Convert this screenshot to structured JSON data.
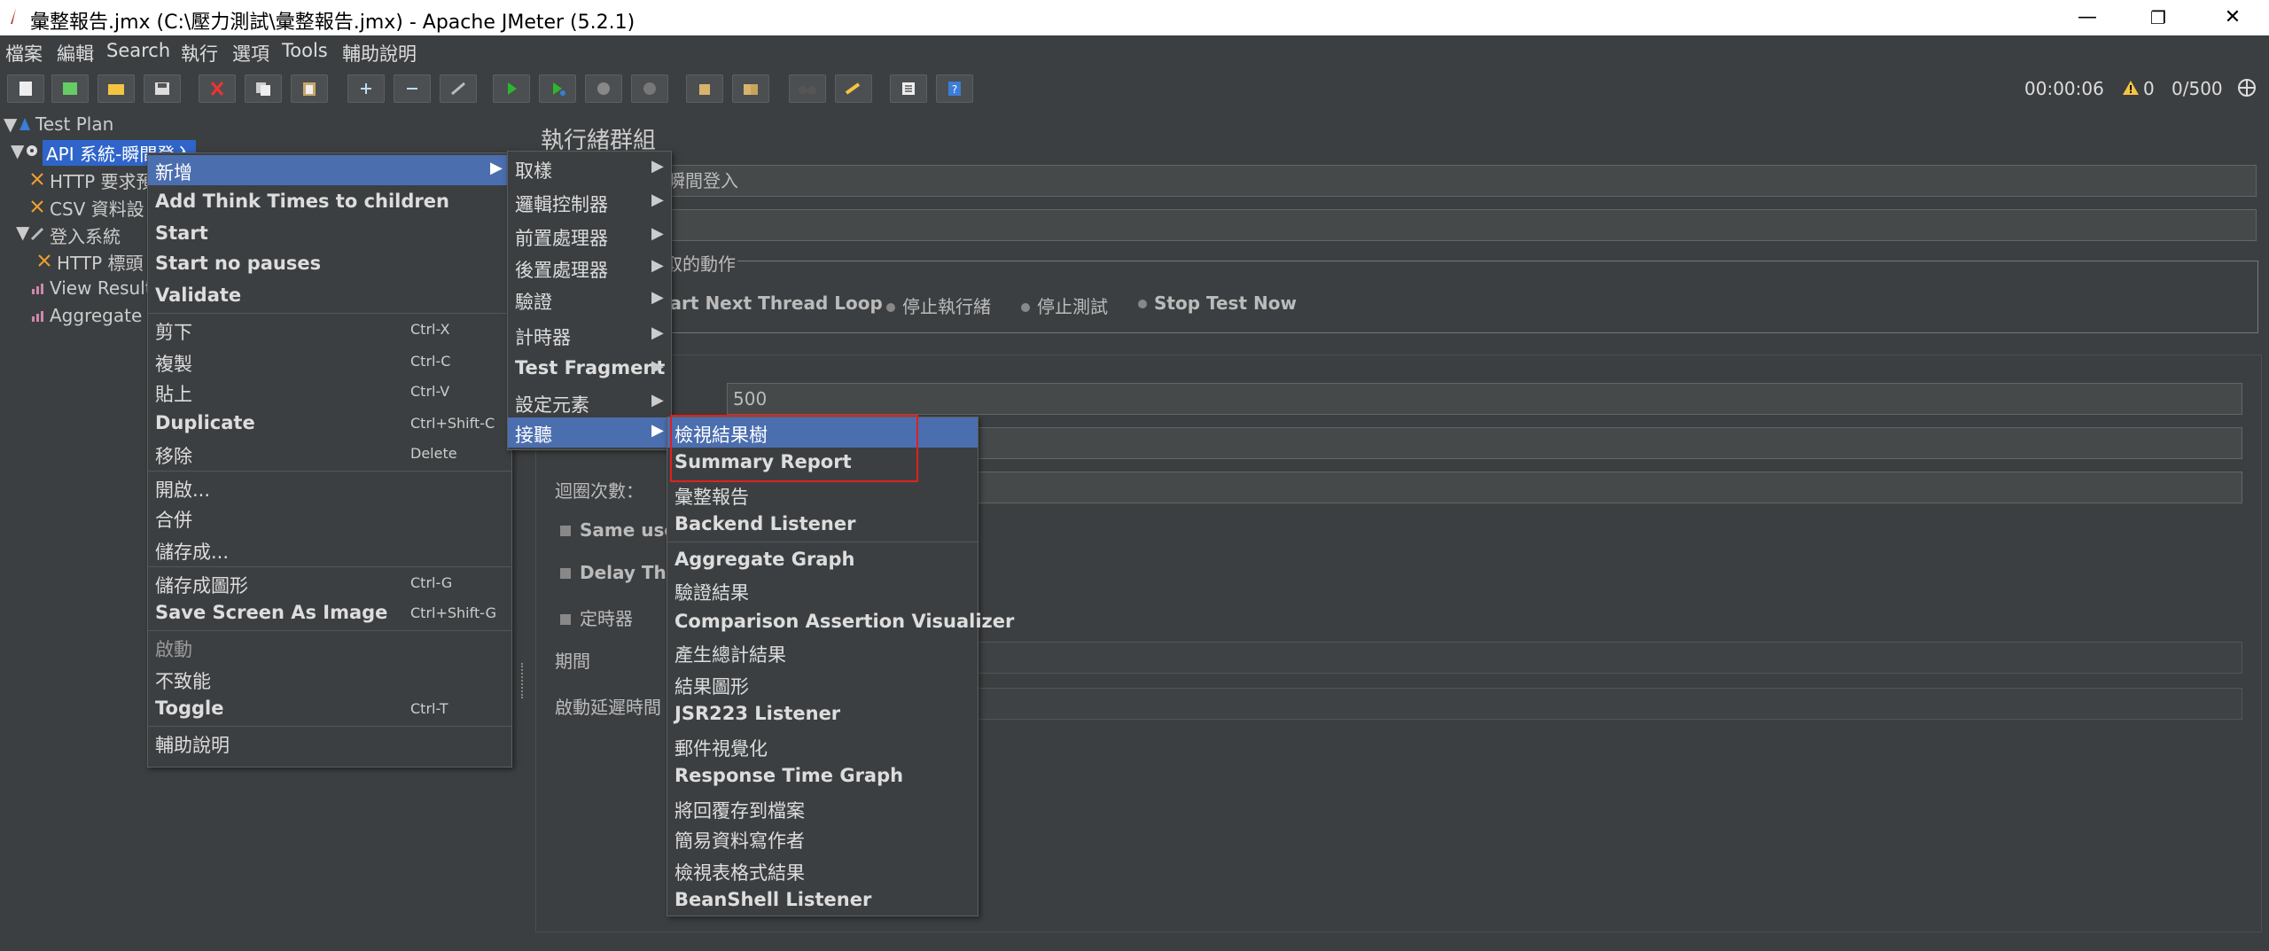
{
  "window": {
    "title": "彙整報告.jmx (C:\\壓力測試\\彙整報告.jmx) - Apache JMeter (5.2.1)",
    "minimize": "—",
    "restore": "❐",
    "close": "✕"
  },
  "menubar": [
    "檔案",
    "編輯",
    "Search",
    "執行",
    "選項",
    "Tools",
    "輔助說明"
  ],
  "status": {
    "timer": "00:00:06",
    "warnings": "0",
    "threads": "0/500"
  },
  "tree": [
    {
      "label": "Test Plan"
    },
    {
      "label": "API 系統-瞬間登入"
    },
    {
      "label": "HTTP 要求預"
    },
    {
      "label": "CSV 資料設"
    },
    {
      "label": "登入系統"
    },
    {
      "label": "HTTP 標頭"
    },
    {
      "label": "View Result"
    },
    {
      "label": "Aggregate R"
    }
  ],
  "panel": {
    "title": "執行緒群組",
    "name_value": "瞬間登入",
    "action_legend": "取的動作",
    "actions": [
      "tart Next Thread Loop",
      "停止執行緒",
      "停止測試",
      "Stop Test Now"
    ],
    "threads_value": "500",
    "loop_label": "迴圈次數：",
    "same_user": "Same use",
    "delay_thread": "Delay Thre",
    "scheduler": "定時器",
    "duration": "期間",
    "startup_delay": "啟動延遲時間"
  },
  "context_menu": [
    {
      "label": "新增",
      "shortcut": "",
      "arrow": "▶"
    },
    {
      "label": "Add Think Times to children",
      "shortcut": ""
    },
    {
      "label": "Start",
      "shortcut": ""
    },
    {
      "label": "Start no pauses",
      "shortcut": ""
    },
    {
      "label": "Validate",
      "shortcut": ""
    },
    {
      "label": "剪下",
      "shortcut": "Ctrl-X"
    },
    {
      "label": "複製",
      "shortcut": "Ctrl-C"
    },
    {
      "label": "貼上",
      "shortcut": "Ctrl-V"
    },
    {
      "label": "Duplicate",
      "shortcut": "Ctrl+Shift-C"
    },
    {
      "label": "移除",
      "shortcut": "Delete"
    },
    {
      "label": "開啟...",
      "shortcut": ""
    },
    {
      "label": "合併",
      "shortcut": ""
    },
    {
      "label": "儲存成...",
      "shortcut": ""
    },
    {
      "label": "儲存成圖形",
      "shortcut": "Ctrl-G"
    },
    {
      "label": "Save Screen As Image",
      "shortcut": "Ctrl+Shift-G"
    },
    {
      "label": "啟動",
      "shortcut": ""
    },
    {
      "label": "不致能",
      "shortcut": ""
    },
    {
      "label": "Toggle",
      "shortcut": "Ctrl-T"
    },
    {
      "label": "輔助說明",
      "shortcut": ""
    }
  ],
  "add_submenu": [
    {
      "label": "取樣",
      "arrow": "▶"
    },
    {
      "label": "邏輯控制器",
      "arrow": "▶"
    },
    {
      "label": "前置處理器",
      "arrow": "▶"
    },
    {
      "label": "後置處理器",
      "arrow": "▶"
    },
    {
      "label": "驗證",
      "arrow": "▶"
    },
    {
      "label": "計時器",
      "arrow": "▶"
    },
    {
      "label": "Test Fragment",
      "arrow": "▶"
    },
    {
      "label": "設定元素",
      "arrow": "▶"
    },
    {
      "label": "接聽",
      "arrow": "▶"
    }
  ],
  "listener_submenu": [
    "檢視結果樹",
    "Summary Report",
    "彙整報告",
    "Backend Listener",
    "Aggregate Graph",
    "驗證結果",
    "Comparison Assertion Visualizer",
    "產生總計結果",
    "結果圖形",
    "JSR223 Listener",
    "郵件視覺化",
    "Response Time Graph",
    "將回覆存到檔案",
    "簡易資料寫作者",
    "檢視表格式結果",
    "BeanShell Listener"
  ],
  "colors": {
    "selection": "#4b6eaf",
    "highlight_box": "#e02020",
    "bg": "#3c3f41"
  }
}
